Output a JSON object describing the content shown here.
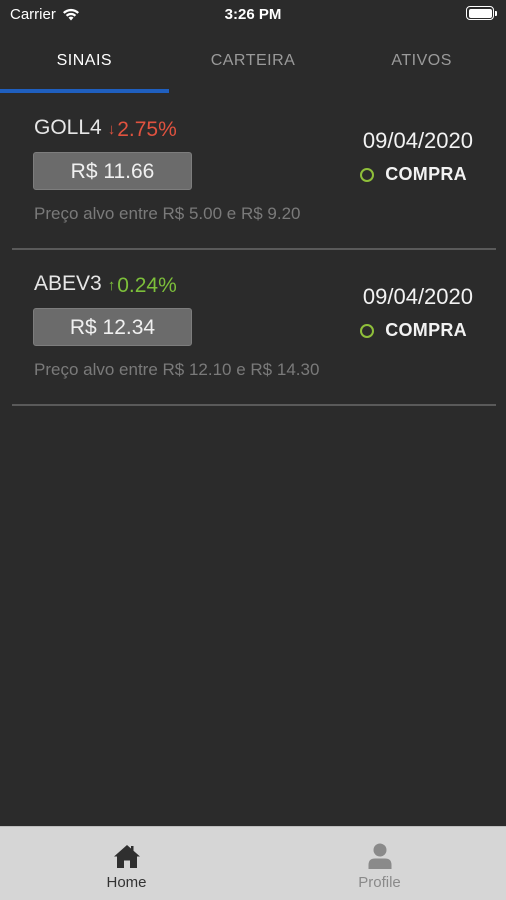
{
  "status_bar": {
    "carrier": "Carrier",
    "time": "3:26 PM"
  },
  "tabs": [
    {
      "label": "SINAIS",
      "active": true
    },
    {
      "label": "CARTEIRA",
      "active": false
    },
    {
      "label": "ATIVOS",
      "active": false
    }
  ],
  "signals": [
    {
      "ticker": "GOLL4",
      "change": "2.75%",
      "direction": "down",
      "price": "R$ 11.66",
      "target": "Preço alvo entre R$ 5.00 e R$ 9.20",
      "date": "09/04/2020",
      "action": "COMPRA"
    },
    {
      "ticker": "ABEV3",
      "change": "0.24%",
      "direction": "up",
      "price": "R$ 12.34",
      "target": "Preço alvo entre R$ 12.10 e R$ 14.30",
      "date": "09/04/2020",
      "action": "COMPRA"
    }
  ],
  "bottom_nav": [
    {
      "label": "Home",
      "icon": "home-icon",
      "active": true
    },
    {
      "label": "Profile",
      "icon": "profile-icon",
      "active": false
    }
  ],
  "colors": {
    "background": "#2b2b2b",
    "accent": "#1f5fbf",
    "down": "#e0523f",
    "up": "#7cbf3a",
    "action_dot": "#8fbf3a"
  }
}
